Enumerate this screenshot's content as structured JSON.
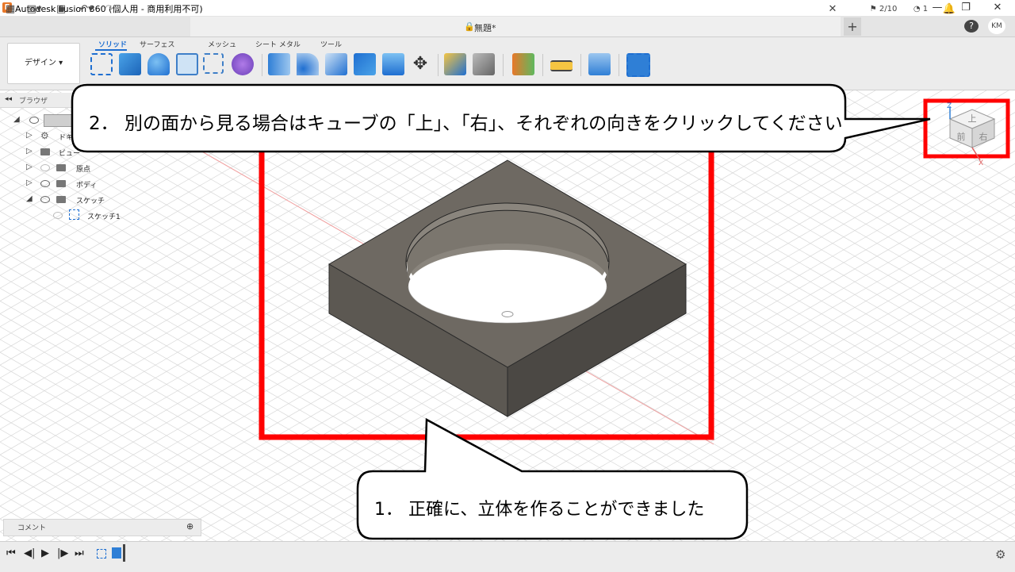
{
  "titlebar": {
    "logo": "F",
    "title": "Autodesk Fusion 360 (個人用 - 商用利用不可)",
    "minimize": "—",
    "restore": "❐",
    "close": "✕"
  },
  "tabbar": {
    "document_title": "無題*",
    "close_tab": "✕",
    "new_tab": "+",
    "jobs_count": "2/10",
    "notifications_count": "1",
    "user_initials": "KM"
  },
  "ribbon": {
    "workspace": "デザイン ▾",
    "tabs": [
      "ソリッド",
      "サーフェス",
      "メッシュ",
      "シート メタル",
      "ツール"
    ]
  },
  "browser": {
    "title": "ブラウザ",
    "items": [
      {
        "label": "ドキュ"
      },
      {
        "label": "ビュー"
      },
      {
        "label": "原点"
      },
      {
        "label": "ボディ"
      },
      {
        "label": "スケッチ"
      },
      {
        "label": "スケッチ1"
      }
    ]
  },
  "comment": {
    "label": "コメント"
  },
  "viewcube": {
    "top": "上",
    "front": "前",
    "right": "右",
    "axis_z": "Z",
    "axis_x": "X"
  },
  "callouts": {
    "step2": "2． 別の面から見る場合はキューブの「上」、「右」、それぞれの向きをクリックしてください",
    "step1": "1． 正確に、立体を作ることができました"
  },
  "colors": {
    "highlight": "#ff0000",
    "accent": "#1f6fd1",
    "model_top": "#6e6962",
    "model_left": "#5a5650",
    "model_right": "#4a4743"
  }
}
